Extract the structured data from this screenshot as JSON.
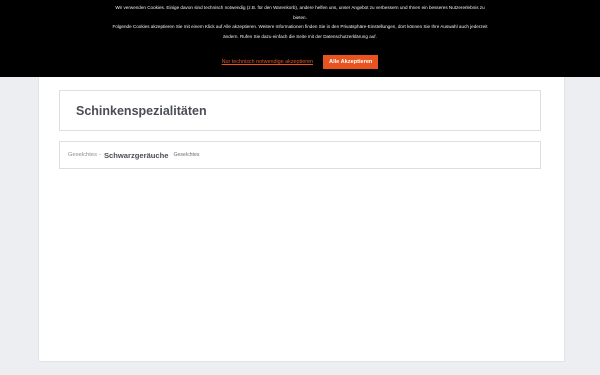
{
  "cookie_banner": {
    "lines": [
      "Wir verwenden Cookies. Einige davon sind technisch notwendig (z.B. für den Warenkorb), andere helfen uns, unser Angebot zu verbessern und Ihnen ein besseres Nutzererlebnis zu",
      "bieten.",
      "Folgende Cookies akzeptieren Sie mit einem Klick auf Alle akzeptieren. Weitere Informationen finden Sie in den Privatsphäre-Einstellungen, dort können Sie Ihre Auswahl auch jederzeit",
      "ändern. Rufen Sie dazu einfach die Seite mit der Datenschutzerklärung auf."
    ],
    "link_necessary": "Nur technisch notwendige akzeptieren",
    "accept_all": "Alle Akzeptieren"
  },
  "main": {
    "title": "Schinkenspezialitäten",
    "breadcrumb": {
      "parent": "Geselchtes",
      "separator": "-",
      "current": "Schwarzgeräuche",
      "tag": "Geselchtes"
    }
  },
  "colors": {
    "accent": "#e8541f",
    "banner_bg": "#000000",
    "page_bg": "#eceef2"
  }
}
